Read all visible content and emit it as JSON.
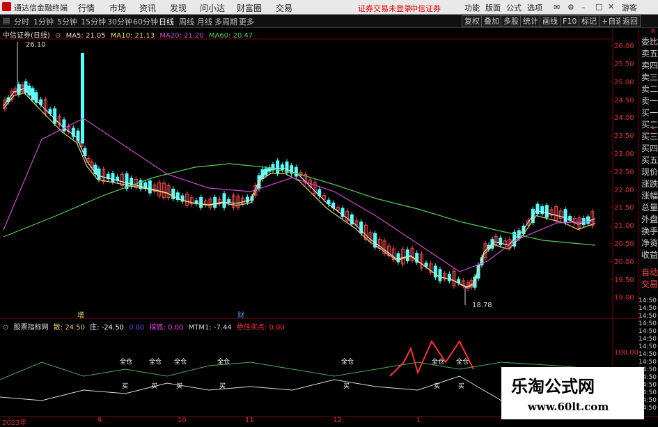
{
  "app": {
    "title": "通达信金融终端",
    "menus": [
      "行情",
      "市场",
      "资讯",
      "发现",
      "问小达",
      "财富圈",
      "交易"
    ],
    "notice_1": "证券交易未登录",
    "notice_2": "中信证券",
    "right_menus": [
      "功能",
      "版面",
      "公式",
      "选项"
    ],
    "guest": "游客"
  },
  "toolbar": {
    "periods": [
      "分时",
      "1分钟",
      "5分钟",
      "15分钟",
      "30分钟",
      "60分钟",
      "日线",
      "周线",
      "月线",
      "多周期",
      "更多"
    ],
    "active": "日线",
    "buttons": [
      "复权",
      "叠加",
      "多股",
      "统计",
      "画线",
      "F10",
      "标记",
      "+自选",
      "返回"
    ]
  },
  "chart": {
    "stock": "中信证券(日线)",
    "ma": [
      {
        "label": "MA5: 21.05",
        "color": "#dddddd"
      },
      {
        "label": "MA10: 21.13",
        "color": "#e8d36a"
      },
      {
        "label": "MA20: 21.20",
        "color": "#d04ad0"
      },
      {
        "label": "MA60: 20.47",
        "color": "#55cc55"
      }
    ],
    "high_label": "26.10",
    "low_label": "18.78",
    "y_ticks": [
      "26.00",
      "25.50",
      "25.00",
      "24.50",
      "24.00",
      "23.50",
      "23.00",
      "22.50",
      "22.00",
      "21.50",
      "21.00",
      "20.50",
      "20.00",
      "19.50",
      "19.00"
    ],
    "markers": [
      "增",
      "财"
    ]
  },
  "side_panel": {
    "items": [
      "委比",
      "卖五",
      "卖四",
      "卖三",
      "卖二",
      "卖一",
      "买一",
      "买二",
      "买三",
      "买四",
      "买五",
      "现价",
      "涨跌",
      "涨幅",
      "总量",
      "外盘",
      "换手",
      "净资",
      "收益",
      "自动",
      "交易"
    ],
    "top_letter": "R",
    "mid_letter": "L"
  },
  "indicator": {
    "name": "股票指标网",
    "series": [
      {
        "label": "散: 24.50",
        "color": "#e8d36a"
      },
      {
        "label": "庄: -24.50",
        "color": "#ffffff"
      },
      {
        "label": "0.00",
        "color": "#5555ff"
      },
      {
        "label": "探底: 0.00",
        "color": "#ff44ff"
      },
      {
        "label": "MTM1: -7.44",
        "color": "#dddddd"
      },
      {
        "label": "绝佳买点: 0.00",
        "color": "#ff3333"
      }
    ],
    "y_tick": "100.00",
    "tag_top": "全仓",
    "tag_bottom": "买"
  },
  "time_ticks": [
    "14:50",
    "14:50",
    "14:50",
    "14:50",
    "14:50",
    "14:50",
    "14:50",
    "14:50",
    "14:50",
    "14:50",
    "14:50",
    "14:50",
    "14:50",
    "14:50",
    "14:50"
  ],
  "x_axis": [
    "2023年",
    "9",
    "10",
    "11",
    "12",
    "1"
  ],
  "watermark": {
    "line1": "乐淘公式网",
    "line2": "www.60lt.com"
  }
}
